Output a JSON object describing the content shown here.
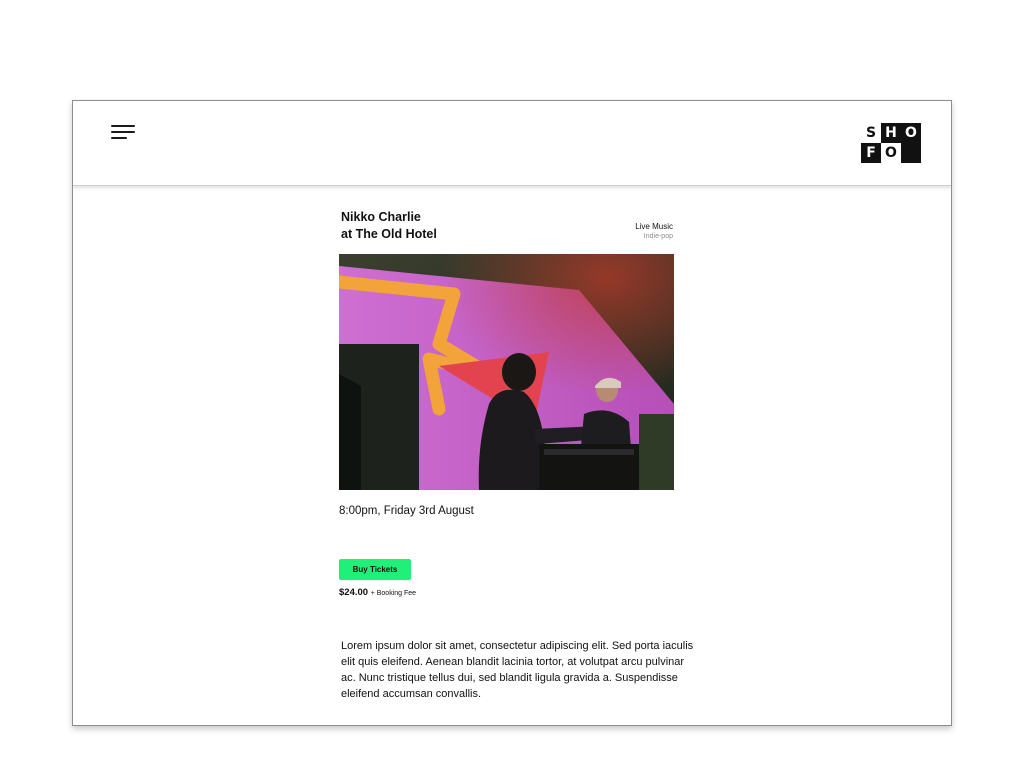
{
  "header": {
    "menu_icon": "hamburger-menu-icon",
    "logo_letters": [
      "S",
      "H",
      "O",
      "F",
      "O",
      ""
    ]
  },
  "event": {
    "title_line1": "Nikko Charlie",
    "title_line2": "at The Old Hotel",
    "category": "Live Music",
    "genre": "Indie-pop",
    "datetime": "8:00pm, Friday 3rd August",
    "buy_label": "Buy Tickets",
    "price": "$24.00",
    "fee": "+ Booking Fee",
    "description": "Lorem ipsum dolor sit amet, consectetur adipiscing elit. Sed porta iaculis elit quis eleifend. Aenean blandit lacinia tortor, at volutpat arcu pulvinar ac. Nunc tristique tellus dui, sed blandit ligula gravida a. Suspendisse eleifend accumsan convallis."
  },
  "colors": {
    "accent": "#1ff07a",
    "stage_pink": "#d46bd0",
    "stage_orange": "#f2a33a"
  }
}
